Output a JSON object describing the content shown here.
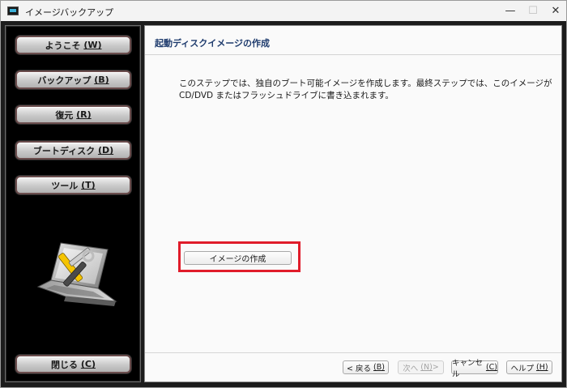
{
  "window": {
    "title": "イメージバックアップ",
    "controls": {
      "minimize": "—",
      "maximize": "☐",
      "close": "✕"
    }
  },
  "sidebar": {
    "items": [
      {
        "label": "ようこそ",
        "accel": "(W)"
      },
      {
        "label": "バックアップ",
        "accel": "(B)"
      },
      {
        "label": "復元",
        "accel": "(R)"
      },
      {
        "label": "ブートディスク",
        "accel": "(D)"
      },
      {
        "label": "ツール",
        "accel": "(T)"
      }
    ],
    "close": {
      "label": "閉じる",
      "accel": "(C)"
    },
    "illustration_icon": "laptop-tools-icon"
  },
  "main": {
    "title": "起動ディスクイメージの作成",
    "description": "このステップでは、独自のブート可能イメージを作成します。最終ステップでは、このイメージが CD/DVD またはフラッシュドライブに書き込まれます。",
    "create_button": "イメージの作成"
  },
  "footer": {
    "back": {
      "label": "< 戻る",
      "accel": "(B)"
    },
    "next": {
      "label": "次へ",
      "accel": "(N)",
      "suffix": " >"
    },
    "cancel": {
      "label": "キャンセル",
      "accel": "(C)"
    },
    "help": {
      "label": "ヘルプ",
      "accel": "(H)"
    }
  },
  "colors": {
    "title_blue": "#1f3c6e",
    "highlight_red": "#e01c2a",
    "sidebar_bg": "#000000"
  }
}
